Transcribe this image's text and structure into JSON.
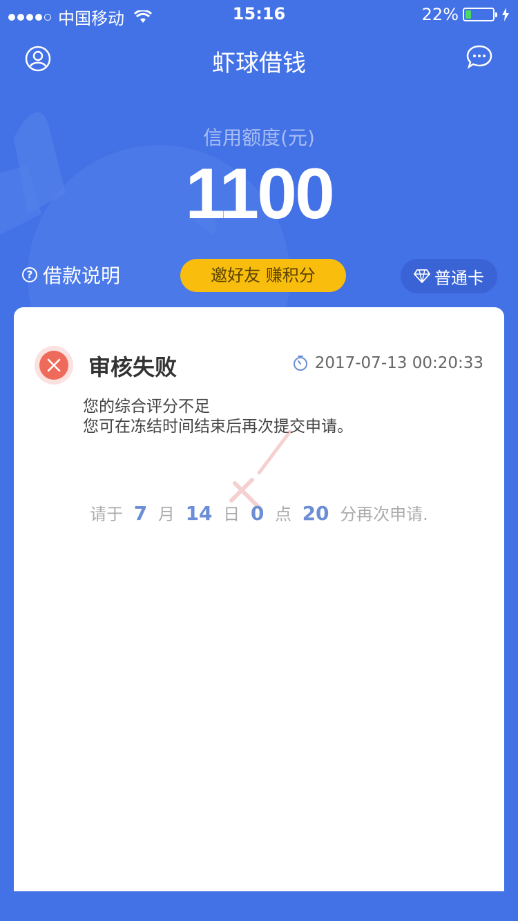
{
  "status_bar": {
    "carrier": "中国移动",
    "time": "15:16",
    "battery": "22%",
    "battery_level": 0.22
  },
  "nav": {
    "title": "虾球借钱",
    "user_icon": "user-icon",
    "chat_icon": "chat-icon"
  },
  "credit": {
    "label": "信用额度(元)",
    "amount": "1100"
  },
  "actions": {
    "loan_info": "借款说明",
    "invite": "邀好友 赚积分",
    "card": "普通卡"
  },
  "review": {
    "title": "审核失败",
    "timestamp": "2017-07-13 00:20:33",
    "line1": "您的综合评分不足",
    "line2": "您可在冻结时间结束后再次提交申请。",
    "retry_prefix": "请于",
    "month": "7",
    "month_unit": "月",
    "day": "14",
    "day_unit": "日",
    "hour": "0",
    "hour_unit": "点",
    "minute": "20",
    "suffix": "分再次申请."
  },
  "colors": {
    "background": "#4371e6",
    "accent_yellow": "#f8bd0d",
    "error_red": "#ee6a5a"
  }
}
